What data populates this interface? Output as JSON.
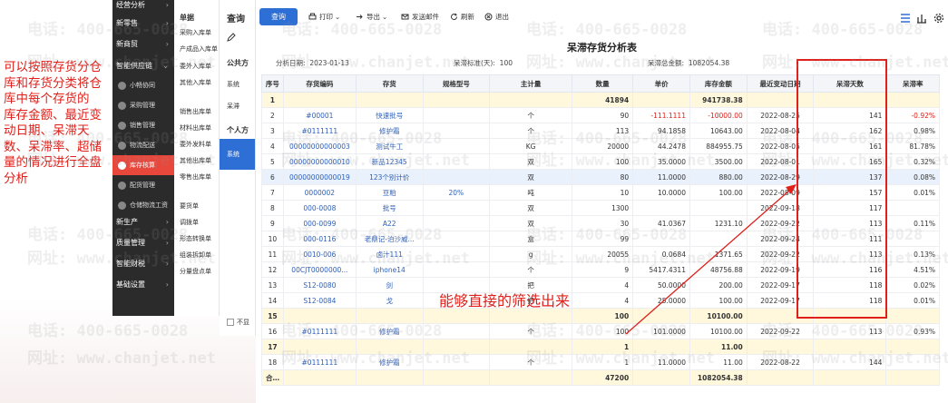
{
  "annotation": {
    "lines": [
      "可以按照存货分仓库和存货分类将仓库中每个存货的",
      "库存金额、最近变动日期、呆滞天数、呆滞率、超储量的情况进行全盘分析"
    ],
    "callout": "能够直接的筛选出来"
  },
  "sidebar": {
    "items": [
      {
        "label": "经营分析"
      },
      {
        "label": "新零售"
      },
      {
        "label": "新商贸"
      },
      {
        "label": "智能供应链"
      },
      {
        "label": "小畅协同"
      },
      {
        "label": "采购管理"
      },
      {
        "label": "销售管理"
      },
      {
        "label": "物流配送"
      },
      {
        "label": "库存核算"
      },
      {
        "label": "配货管理"
      },
      {
        "label": "仓储物流工资"
      },
      {
        "label": "新生产"
      },
      {
        "label": "质量管理"
      },
      {
        "label": "智能财税"
      },
      {
        "label": "基础设置"
      }
    ]
  },
  "submenu": {
    "header": "单据",
    "items": [
      "采购入库单",
      "产成品入库单",
      "委外入库单",
      "其他入库单",
      "销售出库单",
      "材料出库单",
      "委外发料单",
      "其他出库单",
      "零售出库单",
      "要货单",
      "调拨单",
      "形态转换单",
      "组装拆卸单",
      "分量盘点单"
    ]
  },
  "panel": {
    "title": "查询",
    "tabs": [
      "公共方",
      "个人方"
    ],
    "items": [
      "系统",
      "呆滞"
    ],
    "active_item": "系统",
    "checkbox_label": "不显"
  },
  "toolbar": {
    "query": "查询",
    "print": "打印",
    "export": "导出",
    "send": "发送邮件",
    "refresh": "刷新",
    "exit": "退出"
  },
  "report": {
    "title": "呆滞存货分析表",
    "date_label": "分析日期:",
    "date_value": "2023-01-13",
    "std_label": "呆滞标准(天):",
    "std_value": "100",
    "total_label": "呆滞总金额:",
    "total_value": "1082054.38"
  },
  "table": {
    "headers": [
      "序号",
      "存货编码",
      "存货",
      "规格型号",
      "主计量",
      "数量",
      "单价",
      "库存金额",
      "最近变动日期",
      "呆滞天数",
      "呆滞率"
    ],
    "rows": [
      {
        "type": "sub",
        "cells": [
          "1",
          "",
          "",
          "",
          "",
          "41894",
          "",
          "941738.38",
          "",
          "",
          ""
        ]
      },
      {
        "type": "row",
        "cells": [
          "2",
          "#00001",
          "快速批号",
          "",
          "个",
          "90",
          "-111.1111",
          "-10000.00",
          "2022-08-25",
          "141",
          "-0.92%"
        ]
      },
      {
        "type": "row",
        "cells": [
          "3",
          "#0111111",
          "修护霜",
          "",
          "个",
          "113",
          "94.1858",
          "10643.00",
          "2022-08-04",
          "162",
          "0.98%"
        ]
      },
      {
        "type": "row",
        "cells": [
          "4",
          "00000000000003",
          "测试牛工",
          "",
          "KG",
          "20000",
          "44.2478",
          "884955.75",
          "2022-08-05",
          "161",
          "81.78%"
        ]
      },
      {
        "type": "row",
        "cells": [
          "5",
          "00000000000010",
          "新品12345",
          "",
          "双",
          "100",
          "35.0000",
          "3500.00",
          "2022-08-01",
          "165",
          "0.32%"
        ]
      },
      {
        "type": "hl",
        "cells": [
          "6",
          "00000000000019",
          "123个别计价",
          "",
          "双",
          "80",
          "11.0000",
          "880.00",
          "2022-08-29",
          "137",
          "0.08%"
        ]
      },
      {
        "type": "row",
        "cells": [
          "7",
          "0000002",
          "豆粕",
          "20%",
          "吨",
          "10",
          "10.0000",
          "100.00",
          "2022-08-09",
          "157",
          "0.01%"
        ]
      },
      {
        "type": "row",
        "cells": [
          "8",
          "000-0008",
          "批号",
          "",
          "双",
          "1300",
          "",
          "",
          "2022-09-18",
          "117",
          ""
        ]
      },
      {
        "type": "row",
        "cells": [
          "9",
          "000-0099",
          "A22",
          "",
          "双",
          "30",
          "41.0367",
          "1231.10",
          "2022-09-22",
          "113",
          "0.11%"
        ]
      },
      {
        "type": "row",
        "cells": [
          "10",
          "000-0116",
          "老鼎记-泊沙威...",
          "",
          "盒",
          "99",
          "",
          "",
          "2022-09-24",
          "111",
          ""
        ]
      },
      {
        "type": "row",
        "cells": [
          "11",
          "0010-006",
          "卤汁111",
          "",
          "g",
          "20055",
          "0.0684",
          "1371.65",
          "2022-09-22",
          "113",
          "0.13%"
        ]
      },
      {
        "type": "row",
        "cells": [
          "12",
          "00CJT0000000...",
          "iphone14",
          "",
          "个",
          "9",
          "5417.4311",
          "48756.88",
          "2022-09-19",
          "116",
          "4.51%"
        ]
      },
      {
        "type": "row",
        "cells": [
          "13",
          "S12-0080",
          "剑",
          "",
          "把",
          "4",
          "50.0000",
          "200.00",
          "2022-09-17",
          "118",
          "0.02%"
        ]
      },
      {
        "type": "row",
        "cells": [
          "14",
          "S12-0084",
          "戈",
          "",
          "把",
          "4",
          "25.0000",
          "100.00",
          "2022-09-17",
          "118",
          "0.01%"
        ]
      },
      {
        "type": "sub",
        "cells": [
          "15",
          "",
          "",
          "",
          "",
          "100",
          "",
          "10100.00",
          "",
          "",
          ""
        ]
      },
      {
        "type": "row",
        "cells": [
          "16",
          "#0111111",
          "修护霜",
          "",
          "个",
          "100",
          "101.0000",
          "10100.00",
          "2022-09-22",
          "113",
          "0.93%"
        ]
      },
      {
        "type": "sub",
        "cells": [
          "17",
          "",
          "",
          "",
          "",
          "1",
          "",
          "11.00",
          "",
          "",
          ""
        ]
      },
      {
        "type": "row",
        "cells": [
          "18",
          "#0111111",
          "修护霜",
          "",
          "个",
          "1",
          "11.0000",
          "11.00",
          "2022-08-22",
          "144",
          ""
        ]
      },
      {
        "type": "sub",
        "cells": [
          "合计",
          "",
          "",
          "",
          "",
          "47200",
          "",
          "1082054.38",
          "",
          "",
          ""
        ]
      }
    ]
  },
  "watermarks": {
    "phone": "电话: 400-665-0028",
    "site": "网址: www.chanjet.net"
  }
}
